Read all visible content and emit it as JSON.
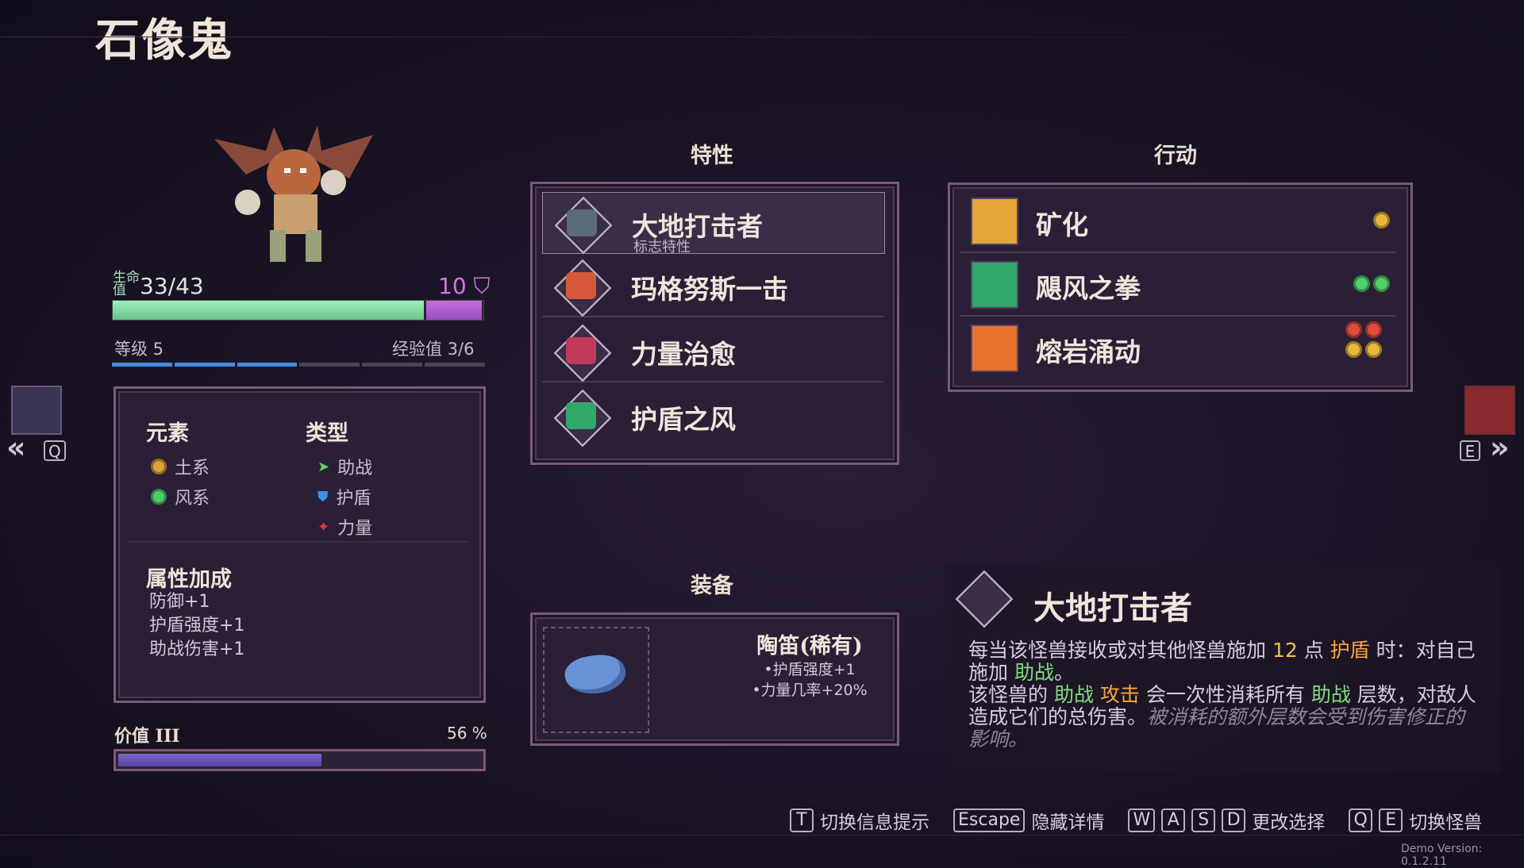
{
  "monster": {
    "name": "石像鬼",
    "hp_label": "生命值",
    "hp": "33/43",
    "hp_fraction": 0.844,
    "shield": "10",
    "shield_fraction": 0.15,
    "level": "等级 5",
    "xp": "经验值 3/6",
    "xp_filled": 3,
    "xp_total": 6
  },
  "info": {
    "elements_header": "元素",
    "elements": [
      {
        "label": "土系",
        "color": "#d9a23a"
      },
      {
        "label": "风系",
        "color": "#4fcf6a"
      }
    ],
    "types_header": "类型",
    "types": [
      {
        "label": "助战",
        "color": "#62d05e"
      },
      {
        "label": "护盾",
        "color": "#3a8fe8"
      },
      {
        "label": "力量",
        "color": "#e23a3a"
      }
    ],
    "bonus_header": "属性加成",
    "bonuses": [
      "防御+1",
      "护盾强度+1",
      "助战伤害+1"
    ]
  },
  "value": {
    "label": "价值 III",
    "percent_text": "56 %",
    "fraction": 0.56
  },
  "nav": {
    "left_key": "Q",
    "right_key": "E"
  },
  "traits": {
    "header": "特性",
    "items": [
      {
        "name": "大地打击者",
        "sub": "标志特性",
        "color": "#5b6b78"
      },
      {
        "name": "玛格努斯一击",
        "sub": "",
        "color": "#d45a3a"
      },
      {
        "name": "力量治愈",
        "sub": "",
        "color": "#c23a5a"
      },
      {
        "name": "护盾之风",
        "sub": "",
        "color": "#2fa86a"
      }
    ]
  },
  "actions": {
    "header": "行动",
    "items": [
      {
        "name": "矿化",
        "color": "#e6a63a",
        "costs": [
          "#e8b83a"
        ]
      },
      {
        "name": "飓风之拳",
        "color": "#2fa86a",
        "costs": [
          "#4fcf6a",
          "#4fcf6a"
        ]
      },
      {
        "name": "熔岩涌动",
        "color": "#e8722e",
        "costs": [
          "#e04a3a",
          "#e04a3a",
          "#e8b83a",
          "#e8b83a"
        ]
      }
    ]
  },
  "equipment": {
    "header": "装备",
    "name": "陶笛(稀有)",
    "stats": [
      "•护盾强度+1",
      "•力量几率+20%"
    ]
  },
  "detail": {
    "title": "大地打击者",
    "p1_a": "每当该怪兽接收或对其他怪兽施加 ",
    "p1_num": "12",
    "p1_b": " 点 ",
    "p1_shield": "护盾",
    "p1_c": " 时：对自己施加 ",
    "p1_assist": "助战",
    "p1_d": "。",
    "p2_a": "该怪兽的 ",
    "p2_assist": "助战",
    "p2_sp": " ",
    "p2_attack": "攻击",
    "p2_b": " 会一次性消耗所有 ",
    "p2_assist2": "助战",
    "p2_c": " 层数，对敌人造成它们的总伤害。",
    "p2_note": "被消耗的额外层数会受到伤害修正的影响。"
  },
  "hints": {
    "t_key": "T",
    "t_label": "切换信息提示",
    "esc_key": "Escape",
    "esc_label": "隐藏详情",
    "w_key": "W",
    "a_key": "A",
    "s_key": "S",
    "d_key": "D",
    "move_label": "更改选择",
    "q_key": "Q",
    "e_key": "E",
    "swap_label": "切换怪兽"
  },
  "version": "Demo Version: 0.1.2.11"
}
